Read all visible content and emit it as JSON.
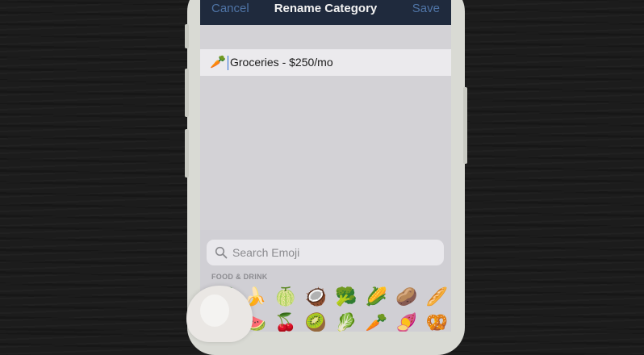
{
  "navbar": {
    "cancel_label": "Cancel",
    "title": "Rename Category",
    "save_label": "Save"
  },
  "category_field": {
    "emoji": "🥕",
    "value": "Groceries - $250/mo"
  },
  "emoji_keyboard": {
    "search_placeholder": "Search Emoji",
    "section_label": "FOOD & DRINK",
    "row1": [
      "🍏",
      "🍌",
      "🍈",
      "🥥",
      "🥦",
      "🌽",
      "🥔",
      "🥖"
    ],
    "row2": [
      "🍉",
      "🍉",
      "🍒",
      "🥝",
      "🥬",
      "🥕",
      "🍠",
      "🥨"
    ]
  },
  "colors": {
    "navbar_bg": "#1f2a3d",
    "nav_button": "#4f74a6",
    "caret": "#2f6fd8"
  }
}
